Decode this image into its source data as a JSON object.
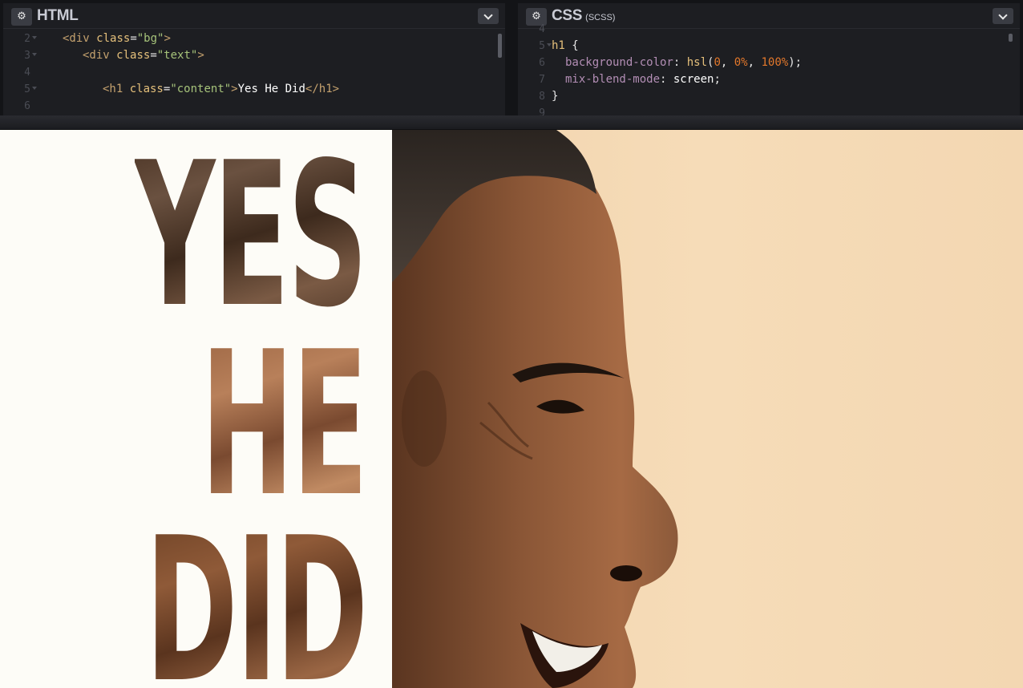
{
  "html_editor": {
    "title": "HTML",
    "lines": [
      {
        "num": "2",
        "fold": true,
        "indent": 0,
        "parts": [
          [
            "tg",
            "<div "
          ],
          [
            "an",
            "class"
          ],
          [
            "eq",
            "="
          ],
          [
            "av",
            "\"bg\""
          ],
          [
            "tg",
            ">"
          ]
        ]
      },
      {
        "num": "3",
        "fold": true,
        "indent": 1,
        "parts": [
          [
            "tg",
            "<div "
          ],
          [
            "an",
            "class"
          ],
          [
            "eq",
            "="
          ],
          [
            "av",
            "\"text\""
          ],
          [
            "tg",
            ">"
          ]
        ]
      },
      {
        "num": "4",
        "fold": false,
        "indent": 0,
        "parts": []
      },
      {
        "num": "5",
        "fold": true,
        "indent": 2,
        "parts": [
          [
            "tg",
            "<h1 "
          ],
          [
            "an",
            "class"
          ],
          [
            "eq",
            "="
          ],
          [
            "av",
            "\"content\""
          ],
          [
            "tg",
            ">"
          ],
          [
            "tx",
            "Yes He Did"
          ],
          [
            "tg",
            "</h1>"
          ]
        ]
      },
      {
        "num": "6",
        "fold": false,
        "indent": 0,
        "parts": []
      }
    ]
  },
  "css_editor": {
    "title": "CSS",
    "subtitle": "(SCSS)",
    "lines": [
      {
        "num": "4",
        "fold": false,
        "indent": 0,
        "parts": []
      },
      {
        "num": "5",
        "fold": true,
        "indent": 0,
        "parts": [
          [
            "sel",
            "h1 "
          ],
          [
            "pun",
            "{"
          ]
        ]
      },
      {
        "num": "6",
        "fold": false,
        "indent": 1,
        "parts": [
          [
            "prop",
            "background-color"
          ],
          [
            "pun",
            ": "
          ],
          [
            "fn",
            "hsl"
          ],
          [
            "pun",
            "("
          ],
          [
            "num",
            "0"
          ],
          [
            "pun",
            ", "
          ],
          [
            "num",
            "0%"
          ],
          [
            "pun",
            ", "
          ],
          [
            "num",
            "100%"
          ],
          [
            "pun",
            ");"
          ]
        ]
      },
      {
        "num": "7",
        "fold": false,
        "indent": 1,
        "parts": [
          [
            "prop",
            "mix-blend-mode"
          ],
          [
            "pun",
            ": "
          ],
          [
            "val",
            "screen"
          ],
          [
            "pun",
            ";"
          ]
        ]
      },
      {
        "num": "8",
        "fold": false,
        "indent": 0,
        "parts": [
          [
            "pun",
            "}"
          ]
        ]
      },
      {
        "num": "9",
        "fold": false,
        "indent": 0,
        "parts": []
      }
    ]
  },
  "preview": {
    "words": [
      "YES",
      "HE",
      "DID"
    ]
  },
  "icons": {
    "settings": "gear-icon",
    "collapse": "chevron-down-icon"
  },
  "colors": {
    "editor_bg": "#1d1e22",
    "preview_bg": "#fdfcf7",
    "photo_bg": "#f3d7b2"
  }
}
